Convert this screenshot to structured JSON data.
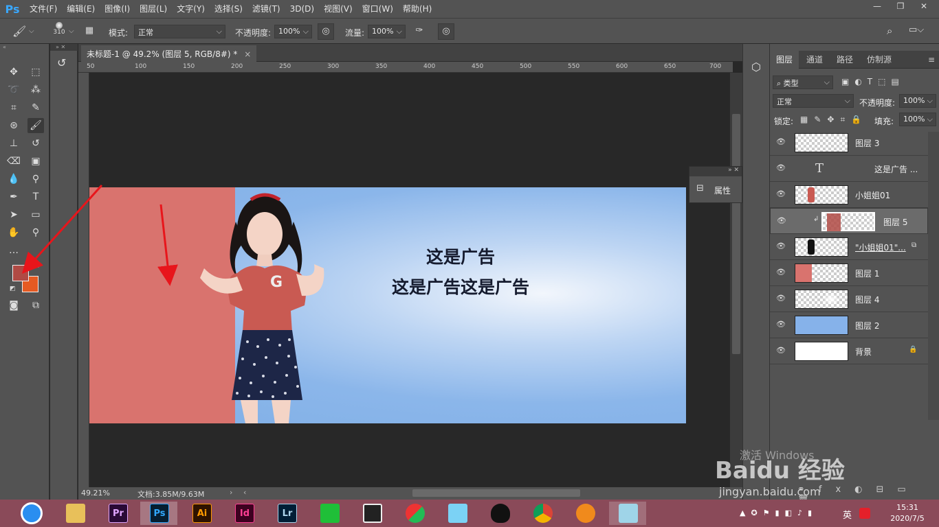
{
  "app": {
    "logo": "Ps"
  },
  "menu": [
    "文件(F)",
    "编辑(E)",
    "图像(I)",
    "图层(L)",
    "文字(Y)",
    "选择(S)",
    "滤镜(T)",
    "3D(D)",
    "视图(V)",
    "窗口(W)",
    "帮助(H)"
  ],
  "options": {
    "brush_size": "310",
    "mode_label": "模式:",
    "mode_value": "正常",
    "opacity_label": "不透明度:",
    "opacity_value": "100%",
    "flow_label": "流量:",
    "flow_value": "100%"
  },
  "document": {
    "tab_title": "未标题-1 @ 49.2% (图层 5, RGB/8#) *",
    "ruler_top": [
      "50",
      "100",
      "150",
      "200",
      "250",
      "300",
      "350",
      "400",
      "450",
      "500",
      "550",
      "600",
      "650",
      "700"
    ],
    "zoom": "49.21%",
    "doc_info": "文档:3.85M/9.63M"
  },
  "banner": {
    "line1": "这是广告",
    "line2": "这是广告这是广告"
  },
  "properties": {
    "label": "属性"
  },
  "layers_panel": {
    "tabs": [
      "图层",
      "通道",
      "路径",
      "仿制源"
    ],
    "filter_label": "类型",
    "blend_mode": "正常",
    "opacity_label": "不透明度:",
    "opacity_value": "100%",
    "lock_label": "锁定:",
    "fill_label": "填充:",
    "fill_value": "100%",
    "layers": [
      {
        "name": "图层 3"
      },
      {
        "name": "这是广告 ..."
      },
      {
        "name": "小姐姐01"
      },
      {
        "name": "图层 5"
      },
      {
        "name": "\"小姐姐01\"..."
      },
      {
        "name": "图层 1"
      },
      {
        "name": "图层 4"
      },
      {
        "name": "图层 2"
      },
      {
        "name": "背景"
      }
    ]
  },
  "taskbar": {
    "apps": [
      "Pr",
      "Ps",
      "Ai",
      "Id",
      "Lr"
    ],
    "ime": "英",
    "time": "15:31",
    "date": "2020/7/5"
  },
  "watermark": {
    "activate": "激活 Windows",
    "brand": "Baidu 经验",
    "url": "jingyan.baidu.com"
  }
}
